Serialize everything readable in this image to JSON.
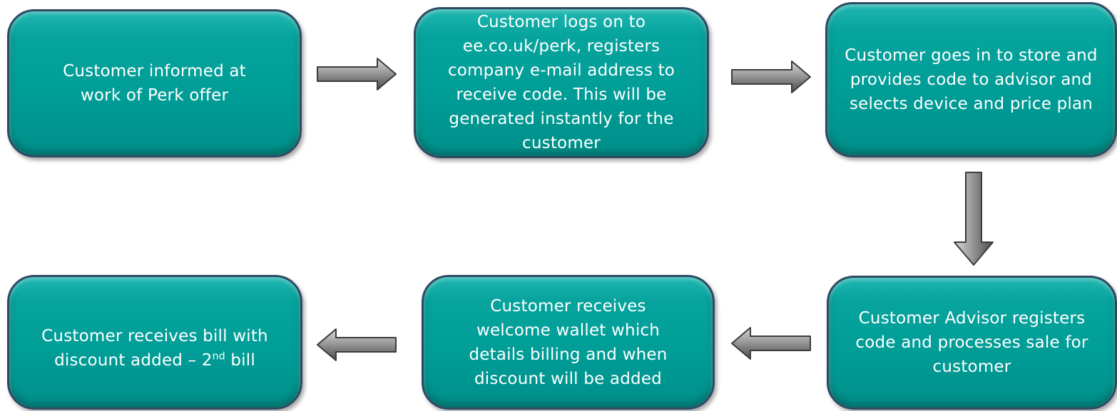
{
  "steps": [
    {
      "id": "informed",
      "text": "Customer informed at work of Perk offer"
    },
    {
      "id": "logs-on",
      "text": "Customer logs on to ee.co.uk/perk, registers company e-mail address to receive code. This will be generated instantly for the customer"
    },
    {
      "id": "goes-to-store",
      "text": "Customer goes in to store and provides code to advisor and selects device and price plan"
    },
    {
      "id": "advisor-registers",
      "text": "Customer Advisor registers code and processes sale for customer"
    },
    {
      "id": "welcome-wallet",
      "text": "Customer receives welcome wallet which details billing and when discount will be added"
    },
    {
      "id": "bill-discount",
      "text_main": "Customer receives bill with discount added – 2",
      "text_sup": "nd",
      "text_end": " bill"
    }
  ],
  "colors": {
    "box_fill": "#009c96",
    "box_border": "#2f4a63",
    "box_text": "#ffffff",
    "arrow_fill": "#8a8a8a",
    "arrow_stroke": "#3c3c3c"
  }
}
